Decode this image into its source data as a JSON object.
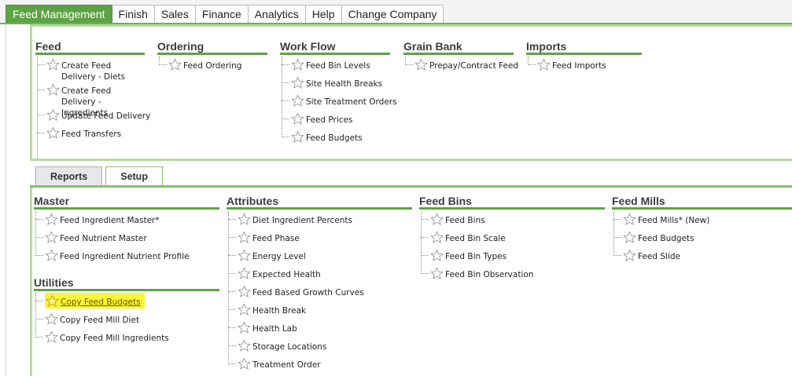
{
  "top_tabs": [
    "Feed Management",
    "Finish",
    "Sales",
    "Finance",
    "Analytics",
    "Help",
    "Change Company"
  ],
  "colors": {
    "accent": "#5ca344",
    "panel_border": "#b6d9a3",
    "highlight": "#fbf537",
    "star_outline": "#9a9a9a",
    "star_highlight": "#d49b00"
  },
  "icons": {
    "item": "star-outline-icon"
  },
  "upper": {
    "feed": {
      "title": "Feed",
      "items": [
        "Create Feed Delivery - Diets",
        "Create Feed Delivery - Ingredients",
        "Update Feed Delivery",
        "Feed Transfers"
      ]
    },
    "ordering": {
      "title": "Ordering",
      "items": [
        "Feed Ordering"
      ]
    },
    "workflow": {
      "title": "Work Flow",
      "items": [
        "Feed Bin Levels",
        "Site Health Breaks",
        "Site Treatment Orders",
        "Feed Prices",
        "Feed Budgets"
      ]
    },
    "grainbank": {
      "title": "Grain Bank",
      "items": [
        "Prepay/Contract Feed"
      ]
    },
    "imports": {
      "title": "Imports",
      "items": [
        "Feed Imports"
      ]
    }
  },
  "sub_tabs": [
    "Reports",
    "Setup"
  ],
  "lower": {
    "master": {
      "title": "Master",
      "items": [
        "Feed Ingredient Master*",
        "Feed Nutrient Master",
        "Feed Ingredient Nutrient Profile"
      ]
    },
    "utilities": {
      "title": "Utilities",
      "items": [
        "Copy Feed Budgets",
        "Copy Feed Mill Diet",
        "Copy Feed Mill Ingredients"
      ]
    },
    "attributes": {
      "title": "Attributes",
      "items": [
        "Diet Ingredient Percents",
        "Feed Phase",
        "Energy Level",
        "Expected Health",
        "Feed Based Growth Curves",
        "Health Break",
        "Health Lab",
        "Storage Locations",
        "Treatment Order"
      ]
    },
    "feedbins": {
      "title": "Feed Bins",
      "items": [
        "Feed Bins",
        "Feed Bin Scale",
        "Feed Bin Types",
        "Feed Bin Observation"
      ]
    },
    "feedmills": {
      "title": "Feed Mills",
      "items": [
        "Feed Mills* (New)",
        "Feed Budgets",
        "Feed Slide"
      ]
    }
  }
}
